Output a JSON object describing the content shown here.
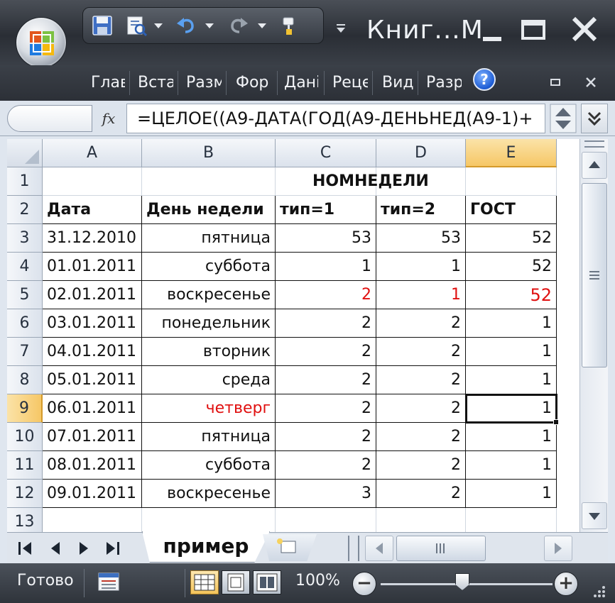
{
  "app": {
    "title": "Книг...М",
    "ribbon_tabs": [
      "Глав",
      "Вста",
      "Разм",
      "Фор",
      "Дані",
      "Реце",
      "Вид",
      "Разр"
    ],
    "help_label": "?"
  },
  "formula_bar": {
    "fx_label": "fx",
    "formula": "=ЦЕЛОЕ((A9-ДАТА(ГОД(A9-ДЕНЬНЕД(A9-1)+"
  },
  "grid": {
    "columns": [
      "A",
      "B",
      "C",
      "D",
      "E"
    ],
    "active_column": "E",
    "active_row": 9,
    "rows": [
      {
        "num": "1",
        "cells": [
          "",
          "",
          "НОМНЕДЕЛИ",
          "",
          ""
        ]
      },
      {
        "num": "2",
        "cells": [
          "Дата",
          "День недели",
          "тип=1",
          "тип=2",
          "ГОСТ"
        ]
      },
      {
        "num": "3",
        "cells": [
          "31.12.2010",
          "пятница",
          "53",
          "53",
          "52"
        ]
      },
      {
        "num": "4",
        "cells": [
          "01.01.2011",
          "суббота",
          "1",
          "1",
          "52"
        ]
      },
      {
        "num": "5",
        "cells": [
          "02.01.2011",
          "воскресенье",
          "2",
          "1",
          "52"
        ]
      },
      {
        "num": "6",
        "cells": [
          "03.01.2011",
          "понедельник",
          "2",
          "2",
          "1"
        ]
      },
      {
        "num": "7",
        "cells": [
          "04.01.2011",
          "вторник",
          "2",
          "2",
          "1"
        ]
      },
      {
        "num": "8",
        "cells": [
          "05.01.2011",
          "среда",
          "2",
          "2",
          "1"
        ]
      },
      {
        "num": "9",
        "cells": [
          "06.01.2011",
          "четверг",
          "2",
          "2",
          "1"
        ]
      },
      {
        "num": "10",
        "cells": [
          "07.01.2011",
          "пятница",
          "2",
          "2",
          "1"
        ]
      },
      {
        "num": "11",
        "cells": [
          "08.01.2011",
          "суббота",
          "2",
          "2",
          "1"
        ]
      },
      {
        "num": "12",
        "cells": [
          "09.01.2011",
          "воскресенье",
          "3",
          "2",
          "1"
        ]
      },
      {
        "num": "13",
        "cells": [
          "",
          "",
          "",
          "",
          ""
        ]
      }
    ],
    "red_color": "#e01010",
    "accent_header": "#f6c766"
  },
  "sheets": {
    "active": "пример"
  },
  "status": {
    "ready": "Готово",
    "zoom": "100%",
    "zoom_level_percent": 100,
    "zoom_out": "−",
    "zoom_in": "+"
  },
  "icons": {
    "office_button": "office-logo-icon",
    "save": "save-icon",
    "undo": "undo-icon",
    "redo": "redo-icon",
    "minimize": "minimize-icon",
    "maximize": "maximize-icon",
    "close": "close-icon"
  }
}
